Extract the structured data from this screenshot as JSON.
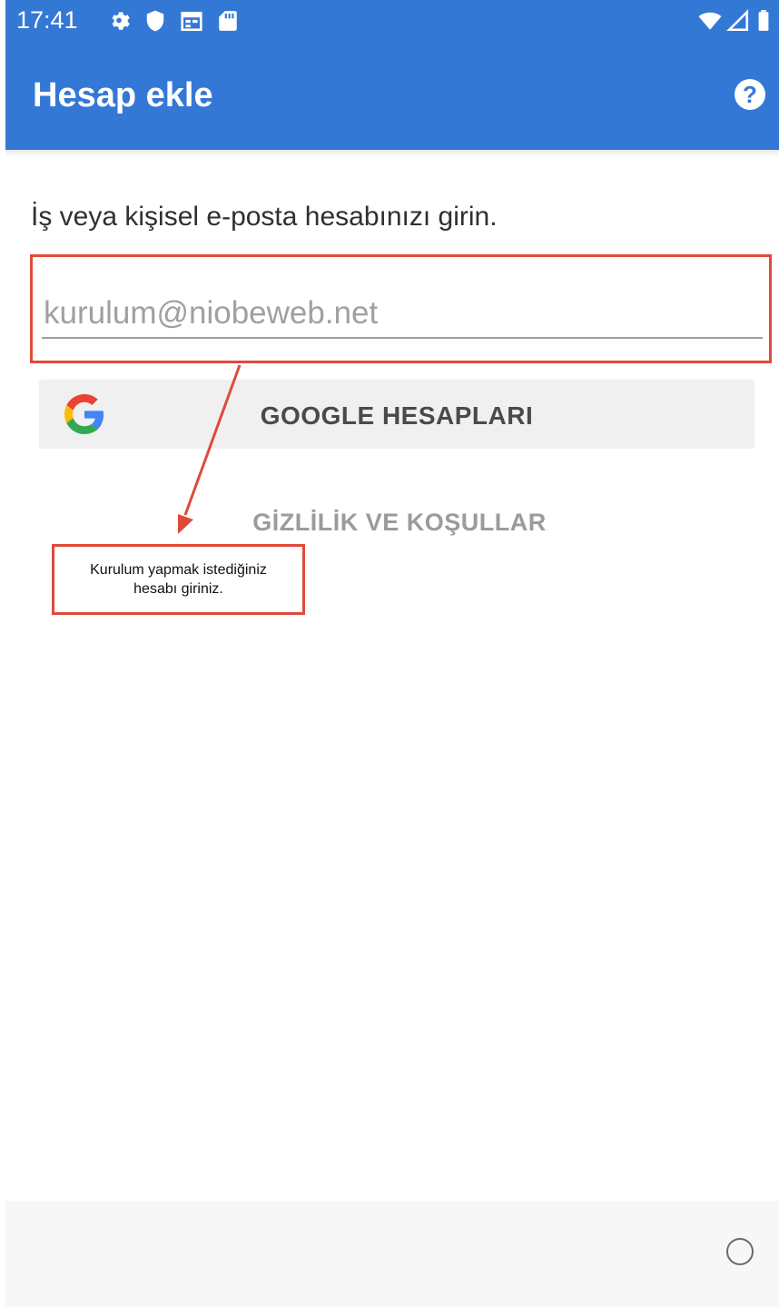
{
  "status_bar": {
    "time": "17:41",
    "left_icons": [
      "gear-icon",
      "shield-icon",
      "calendar-icon",
      "sd-card-icon"
    ],
    "right_icons": [
      "wifi-icon",
      "cellular-signal-icon",
      "battery-icon"
    ]
  },
  "app_bar": {
    "title": "Hesap ekle",
    "help_icon": "help-icon",
    "color": "#3478d6"
  },
  "form": {
    "instruction": "İş veya kişisel e-posta hesabınızı girin.",
    "email_value": "",
    "email_placeholder": "kurulum@niobeweb.net",
    "google_button_label": "GOOGLE HESAPLARI",
    "privacy_link": "GİZLİLİK VE KOŞULLAR"
  },
  "annotation": {
    "callout_text": "Kurulum yapmak istediğiniz\nhesabı giriniz.",
    "color": "#e04a3a"
  },
  "nav_bar": {
    "recents_icon": "circle-icon"
  }
}
